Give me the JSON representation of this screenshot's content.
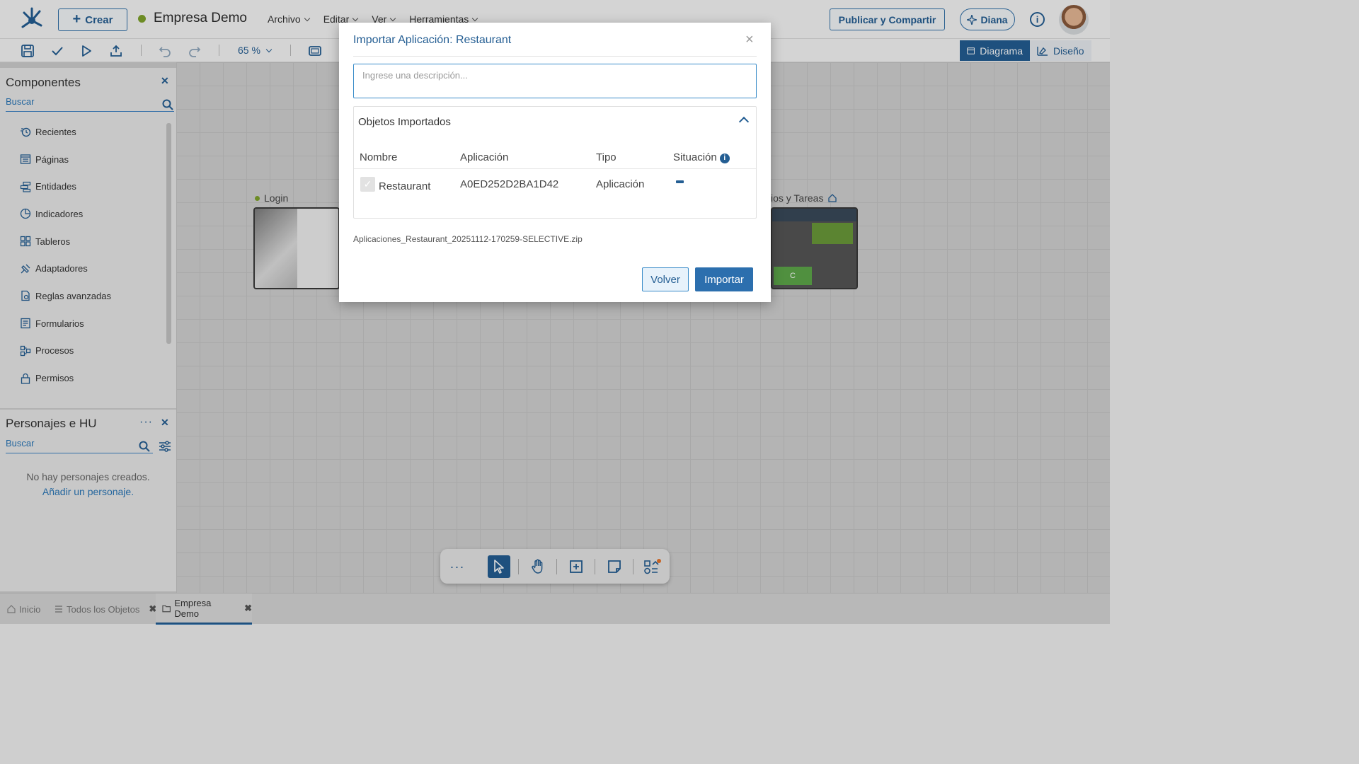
{
  "header": {
    "create_label": "Crear",
    "app_title": "Empresa Demo",
    "menu": [
      "Archivo",
      "Editar",
      "Ver",
      "Herramientas"
    ],
    "publish_label": "Publicar y Compartir",
    "diana_label": "Diana",
    "info_label": "i"
  },
  "toolbar": {
    "zoom": "65 %",
    "view_diagram": "Diagrama",
    "view_design": "Diseño"
  },
  "components_panel": {
    "title": "Componentes",
    "search_placeholder": "Buscar",
    "items": [
      {
        "label": "Recientes",
        "icon": "recent-icon"
      },
      {
        "label": "Páginas",
        "icon": "pages-icon"
      },
      {
        "label": "Entidades",
        "icon": "entities-icon"
      },
      {
        "label": "Indicadores",
        "icon": "indicators-icon"
      },
      {
        "label": "Tableros",
        "icon": "dashboards-icon"
      },
      {
        "label": "Adaptadores",
        "icon": "adapters-icon"
      },
      {
        "label": "Reglas avanzadas",
        "icon": "rules-icon"
      },
      {
        "label": "Formularios",
        "icon": "forms-icon"
      },
      {
        "label": "Procesos",
        "icon": "processes-icon"
      },
      {
        "label": "Permisos",
        "icon": "permissions-icon"
      }
    ]
  },
  "personas_panel": {
    "title": "Personajes e HU",
    "search_placeholder": "Buscar",
    "empty_text": "No hay personajes creados.",
    "add_link": "Añadir un personaje."
  },
  "canvas": {
    "nodes": [
      {
        "label": "Login"
      },
      {
        "label": "ios y Tareas"
      }
    ]
  },
  "bottom_tabs": [
    {
      "label": "Inicio",
      "icon": "home-icon",
      "closable": false
    },
    {
      "label": "Todos los Objetos",
      "icon": "list-icon",
      "closable": true
    },
    {
      "label": "Empresa Demo",
      "icon": "folder-icon",
      "closable": true,
      "active": true
    }
  ],
  "modal": {
    "title": "Importar Aplicación: Restaurant",
    "close_label": "×",
    "description_placeholder": "Ingrese una descripción...",
    "description_value": "",
    "section_title": "Objetos Importados",
    "columns": [
      "Nombre",
      "Aplicación",
      "Tipo",
      "Situación"
    ],
    "rows": [
      {
        "nombre": "Restaurant",
        "aplicacion": "A0ED252D2BA1D42",
        "tipo": "Aplicación",
        "situacion": "-"
      }
    ],
    "file_name": "Aplicaciones_Restaurant_20251112-170259-SELECTIVE.zip",
    "back_label": "Volver",
    "import_label": "Importar"
  },
  "colors": {
    "accent": "#245e93",
    "status_green": "#7fa32c",
    "link": "#2a77b8"
  }
}
